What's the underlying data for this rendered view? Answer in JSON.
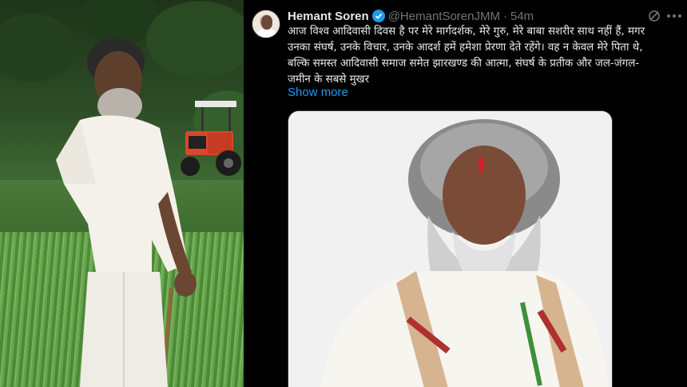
{
  "tweet": {
    "display_name": "Hemant Soren",
    "handle": "@HemantSorenJMM",
    "separator": "·",
    "time": "54m",
    "text": "आज विश्व आदिवासी दिवस है पर मेरे मार्गदर्शक, मेरे गुरु, मेरे बाबा सशरीर साथ नहीं हैं, मगर\nउनका संघर्ष, उनके विचार, उनके आदर्श हमें हमेशा प्रेरणा देते रहेंगे। वह न केवल मेरे पिता थे,\nबल्कि समस्त आदिवासी समाज समेत झारखण्ड की आत्मा, संघर्ष के प्रतीक और जल-जंगल-\nजमीन के सबसे मुखर",
    "show_more": "Show more"
  },
  "icons": {
    "verified": "verified-badge-icon",
    "grok": "grok-icon",
    "more": "more-options-icon"
  },
  "colors": {
    "background": "#000000",
    "text": "#e7e9ea",
    "secondary": "#71767b",
    "accent": "#1d9bf0"
  }
}
